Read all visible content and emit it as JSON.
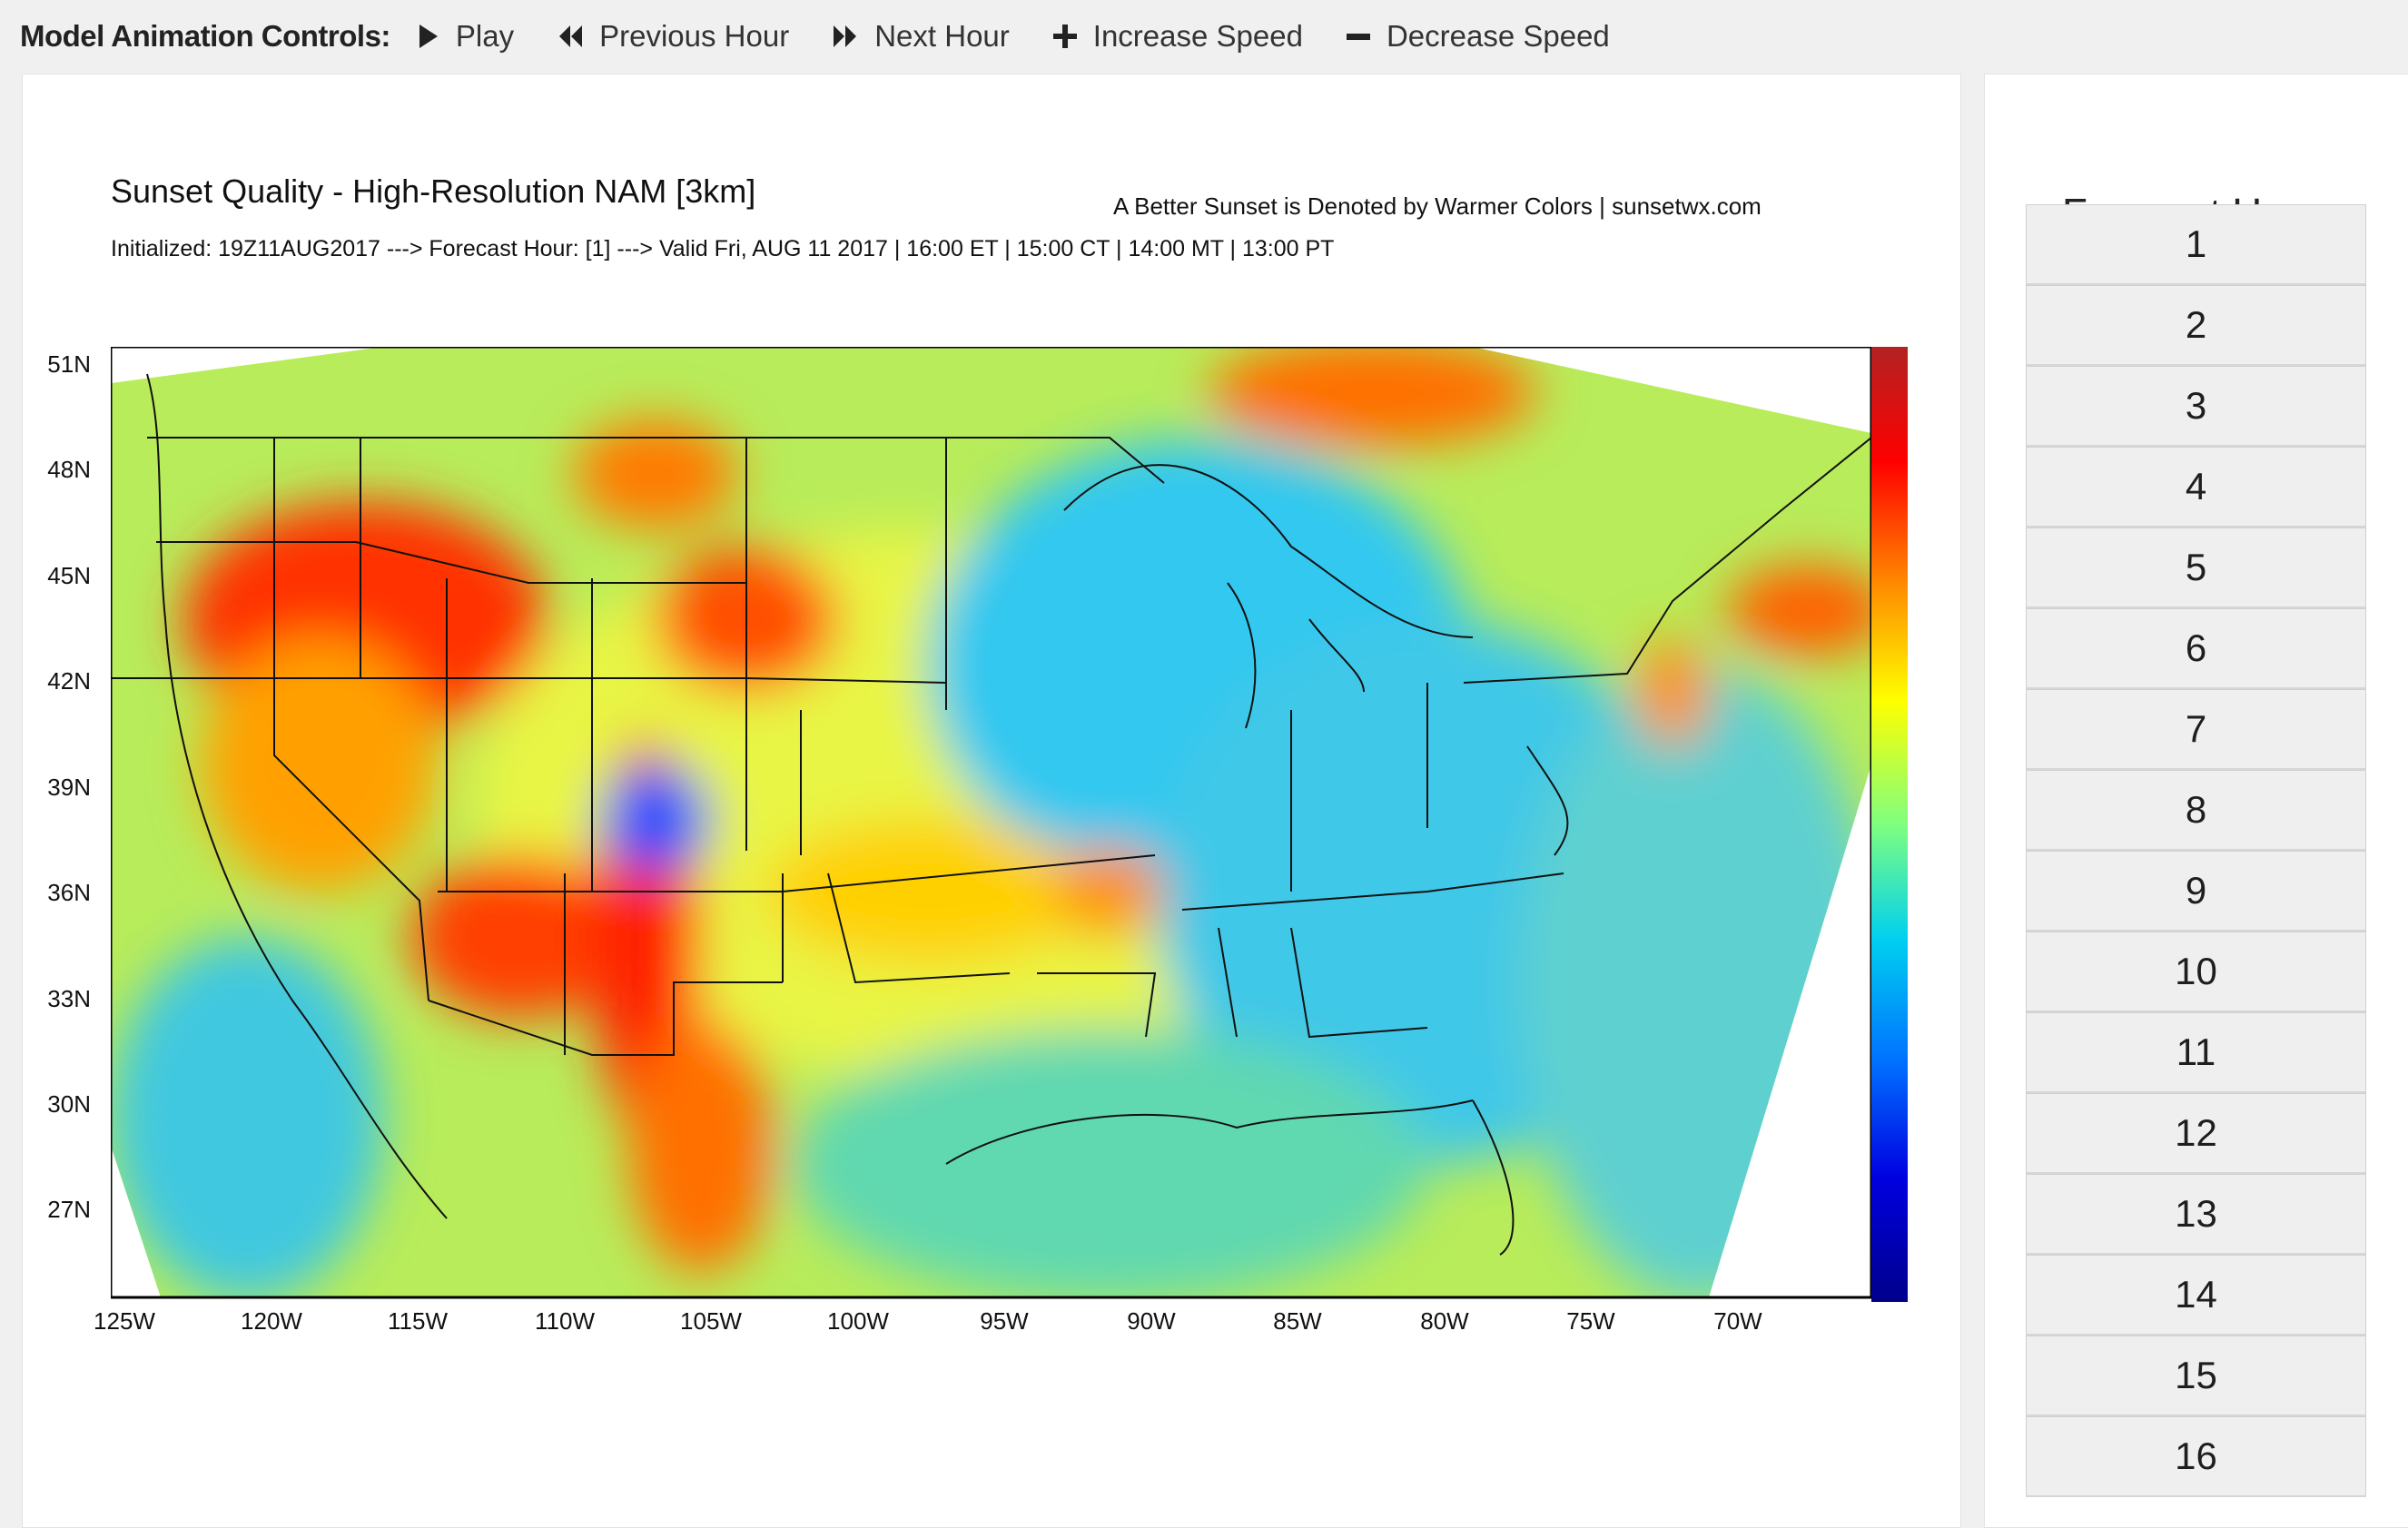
{
  "toolbar": {
    "label": "Model Animation Controls:",
    "buttons": [
      {
        "label": "Play",
        "icon": "play-icon"
      },
      {
        "label": "Previous Hour",
        "icon": "backward-icon"
      },
      {
        "label": "Next Hour",
        "icon": "forward-icon"
      },
      {
        "label": "Increase Speed",
        "icon": "plus-icon"
      },
      {
        "label": "Decrease Speed",
        "icon": "minus-icon"
      }
    ]
  },
  "chart": {
    "title": "Sunset Quality - High-Resolution NAM [3km]",
    "subtitle": "Initialized: 19Z11AUG2017 ---> Forecast Hour: [1] ---> Valid Fri, AUG 11 2017 | 16:00 ET | 15:00 CT | 14:00 MT | 13:00 PT",
    "credit": "A Better Sunset is Denoted by Warmer Colors | sunsetwx.com",
    "lat_ticks": [
      "51N",
      "48N",
      "45N",
      "42N",
      "39N",
      "36N",
      "33N",
      "30N",
      "27N"
    ],
    "lon_ticks": [
      "125W",
      "120W",
      "115W",
      "110W",
      "105W",
      "100W",
      "95W",
      "90W",
      "85W",
      "80W",
      "75W",
      "70W"
    ],
    "colorbar": [
      "#b22222",
      "#ff0000",
      "#ff8c00",
      "#ffff00",
      "#7fff7f",
      "#00bfff",
      "#0050ff",
      "#00008b"
    ]
  },
  "sidebar": {
    "title": "Forecast Hour:",
    "hours": [
      "1",
      "2",
      "3",
      "4",
      "5",
      "6",
      "7",
      "8",
      "9",
      "10",
      "11",
      "12",
      "13",
      "14",
      "15",
      "16"
    ]
  }
}
